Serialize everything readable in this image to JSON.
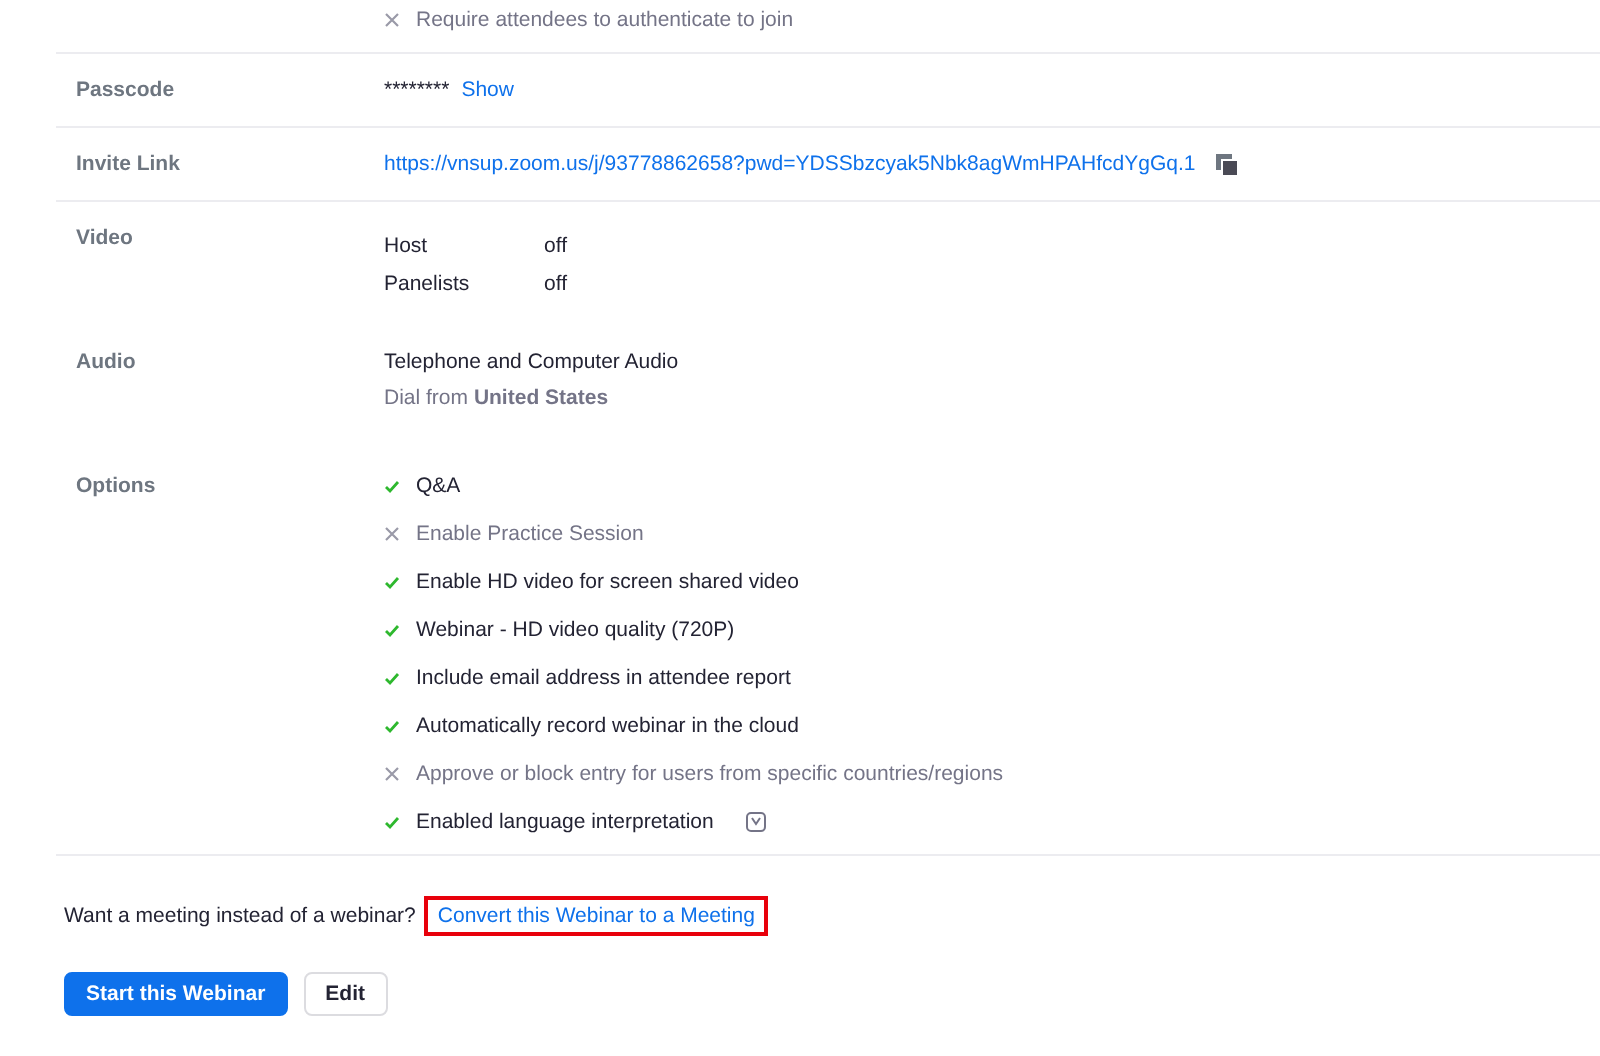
{
  "auth_option": {
    "label": "Require attendees to authenticate to join",
    "checked": false
  },
  "passcode": {
    "label": "Passcode",
    "masked": "********",
    "show_link": "Show"
  },
  "invite_link": {
    "label": "Invite Link",
    "url": "https://vnsup.zoom.us/j/93778862658?pwd=YDSSbzcyak5Nbk8agWmHPAHfcdYgGq.1"
  },
  "video": {
    "label": "Video",
    "rows": [
      {
        "name": "Host",
        "value": "off"
      },
      {
        "name": "Panelists",
        "value": "off"
      }
    ]
  },
  "audio": {
    "label": "Audio",
    "value": "Telephone and Computer Audio",
    "dial_prefix": "Dial from",
    "dial_country": "United States"
  },
  "options": {
    "label": "Options",
    "items": [
      {
        "label": "Q&A",
        "checked": true
      },
      {
        "label": "Enable Practice Session",
        "checked": false
      },
      {
        "label": "Enable HD video for screen shared video",
        "checked": true
      },
      {
        "label": "Webinar - HD video quality (720P)",
        "checked": true
      },
      {
        "label": "Include email address in attendee report",
        "checked": true
      },
      {
        "label": "Automatically record webinar in the cloud",
        "checked": true
      },
      {
        "label": "Approve or block entry for users from specific countries/regions",
        "checked": false
      },
      {
        "label": "Enabled language interpretation",
        "checked": true,
        "info": true
      }
    ]
  },
  "convert": {
    "prompt": "Want a meeting instead of a webinar?",
    "link": "Convert this Webinar to a Meeting",
    "highlighted": true
  },
  "buttons": [
    {
      "label": "Start this Webinar",
      "kind": "primary"
    },
    {
      "label": "Edit",
      "kind": "secondary"
    }
  ]
}
